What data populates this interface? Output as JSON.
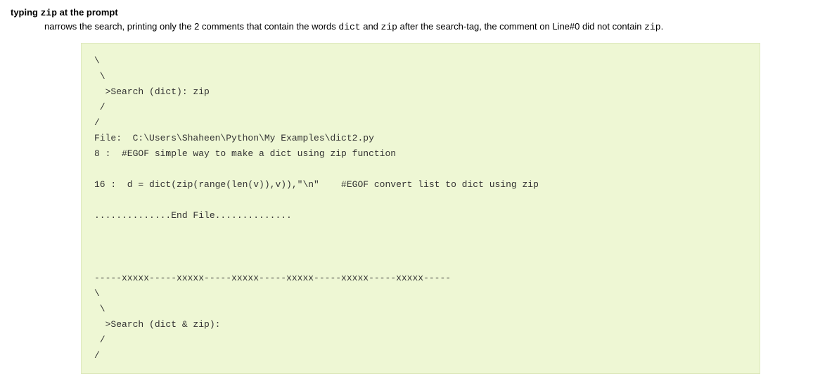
{
  "heading": {
    "prefix": "typing ",
    "code": "zip",
    "suffix": " at the prompt"
  },
  "description": {
    "part1": "narrows the search, printing only the 2 comments that contain the words ",
    "code1": "dict",
    "part2": " and ",
    "code2": "zip",
    "part3": " after the search-tag, the comment on Line#0 did not contain ",
    "code3": "zip",
    "part4": "."
  },
  "code": "\\\n \\\n  >Search (dict): zip\n /\n/\nFile:  C:\\Users\\Shaheen\\Python\\My Examples\\dict2.py\n8 :  #EGOF simple way to make a dict using zip function\n\n16 :  d = dict(zip(range(len(v)),v)),\"\\n\"    #EGOF convert list to dict using zip\n\n..............End File..............\n\n\n\n-----xxxxx-----xxxxx-----xxxxx-----xxxxx-----xxxxx-----xxxxx-----\n\\\n \\\n  >Search (dict & zip):\n /\n/"
}
